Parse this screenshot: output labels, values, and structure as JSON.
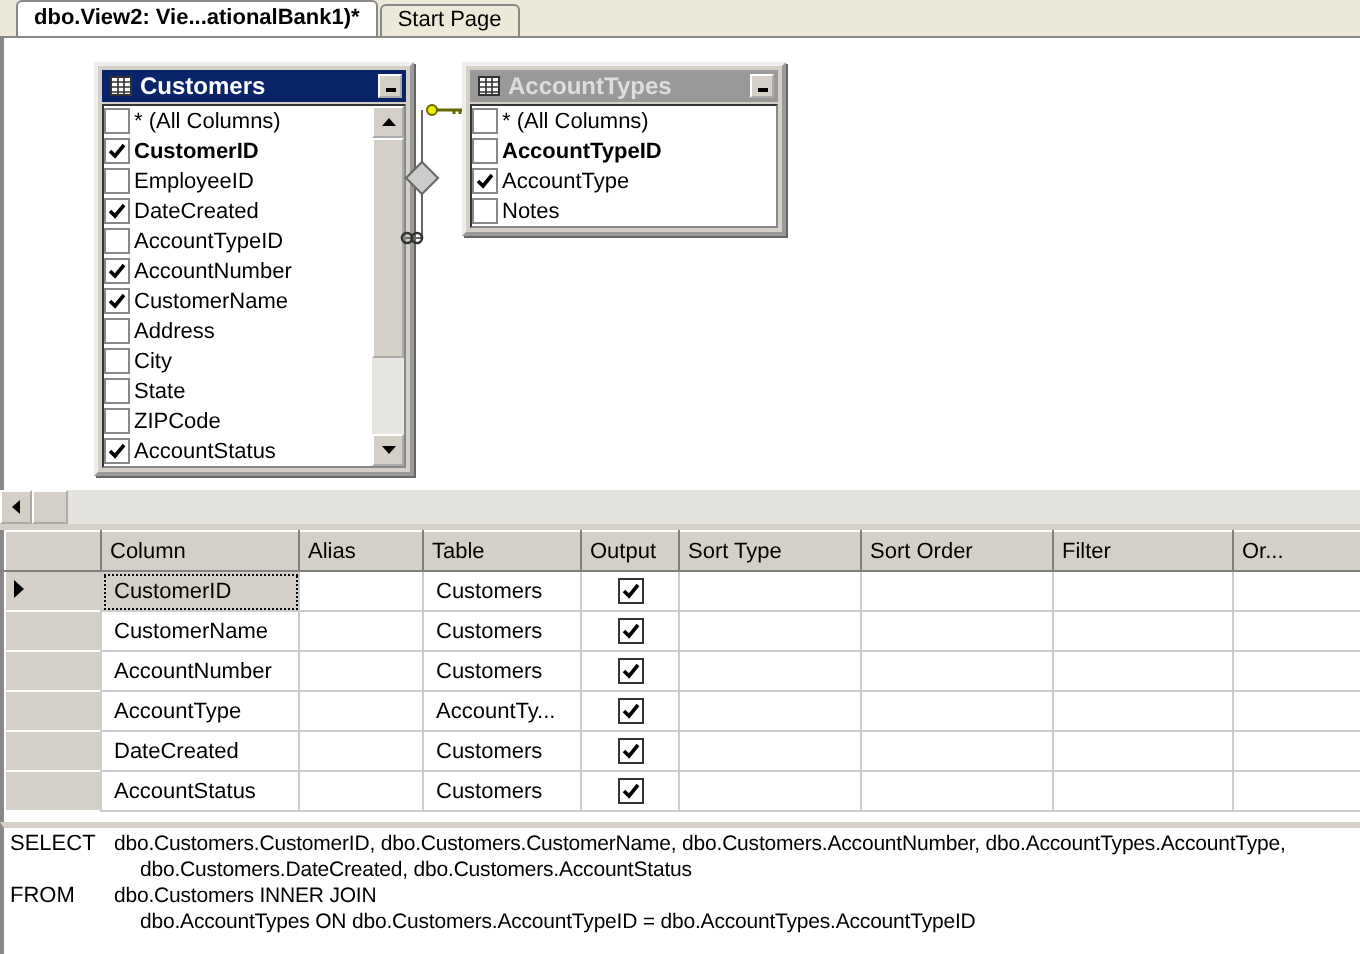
{
  "tabs": [
    {
      "label": "dbo.View2: Vie...ationalBank1)*",
      "selected": true
    },
    {
      "label": "Start Page",
      "selected": false
    }
  ],
  "diagram": {
    "tables": [
      {
        "title": "Customers",
        "active": true,
        "columns": [
          {
            "name": "* (All Columns)",
            "checked": false,
            "key": false
          },
          {
            "name": "CustomerID",
            "checked": true,
            "key": true
          },
          {
            "name": "EmployeeID",
            "checked": false,
            "key": false
          },
          {
            "name": "DateCreated",
            "checked": true,
            "key": false
          },
          {
            "name": "AccountTypeID",
            "checked": false,
            "key": false
          },
          {
            "name": "AccountNumber",
            "checked": true,
            "key": false
          },
          {
            "name": "CustomerName",
            "checked": true,
            "key": false
          },
          {
            "name": "Address",
            "checked": false,
            "key": false
          },
          {
            "name": "City",
            "checked": false,
            "key": false
          },
          {
            "name": "State",
            "checked": false,
            "key": false
          },
          {
            "name": "ZIPCode",
            "checked": false,
            "key": false
          },
          {
            "name": "AccountStatus",
            "checked": true,
            "key": false
          }
        ]
      },
      {
        "title": "AccountTypes",
        "active": false,
        "columns": [
          {
            "name": "* (All Columns)",
            "checked": false,
            "key": false
          },
          {
            "name": "AccountTypeID",
            "checked": false,
            "key": true
          },
          {
            "name": "AccountType",
            "checked": true,
            "key": false
          },
          {
            "name": "Notes",
            "checked": false,
            "key": false
          }
        ]
      }
    ]
  },
  "grid": {
    "columns": [
      "Column",
      "Alias",
      "Table",
      "Output",
      "Sort Type",
      "Sort Order",
      "Filter",
      "Or..."
    ],
    "rows": [
      {
        "column": "CustomerID",
        "table": "Customers",
        "output": true,
        "selected": true
      },
      {
        "column": "CustomerName",
        "table": "Customers",
        "output": true,
        "selected": false
      },
      {
        "column": "AccountNumber",
        "table": "Customers",
        "output": true,
        "selected": false
      },
      {
        "column": "AccountType",
        "table": "AccountTy...",
        "output": true,
        "selected": false
      },
      {
        "column": "DateCreated",
        "table": "Customers",
        "output": true,
        "selected": false
      },
      {
        "column": "AccountStatus",
        "table": "Customers",
        "output": true,
        "selected": false
      }
    ]
  },
  "sql": [
    {
      "keyword": "SELECT",
      "lines": [
        "dbo.Customers.CustomerID, dbo.Customers.CustomerName, dbo.Customers.AccountNumber, dbo.AccountTypes.AccountType,",
        "dbo.Customers.DateCreated, dbo.Customers.AccountStatus"
      ]
    },
    {
      "keyword": "FROM",
      "lines": [
        "dbo.Customers INNER JOIN",
        "dbo.AccountTypes ON dbo.Customers.AccountTypeID = dbo.AccountTypes.AccountTypeID"
      ]
    }
  ]
}
